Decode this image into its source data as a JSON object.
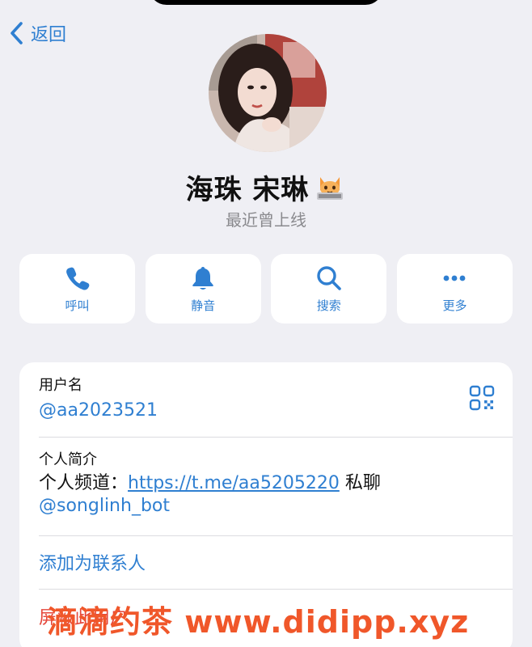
{
  "nav": {
    "back_label": "返回"
  },
  "profile": {
    "name": "海珠 宋琳",
    "status": "最近曾上线"
  },
  "actions": [
    {
      "icon": "phone-icon",
      "label": "呼叫"
    },
    {
      "icon": "bell-icon",
      "label": "静音"
    },
    {
      "icon": "search-icon",
      "label": "搜索"
    },
    {
      "icon": "more-icon",
      "label": "更多"
    }
  ],
  "info": {
    "username_label": "用户名",
    "username": "@aa2023521",
    "bio_label": "个人简介",
    "bio_prefix": "个人频道：",
    "bio_link": "https://t.me/aa5205220",
    "bio_suffix": " 私聊",
    "bio_mention": "@songlinh_bot",
    "add_contact": "添加为联系人",
    "block_user": "屏蔽此用户"
  },
  "watermark": "滴滴约茶 www.didipp.xyz",
  "colors": {
    "accent": "#2f7fd1",
    "background": "#efeff4",
    "danger": "#e5473b",
    "watermark": "#f0572a"
  }
}
